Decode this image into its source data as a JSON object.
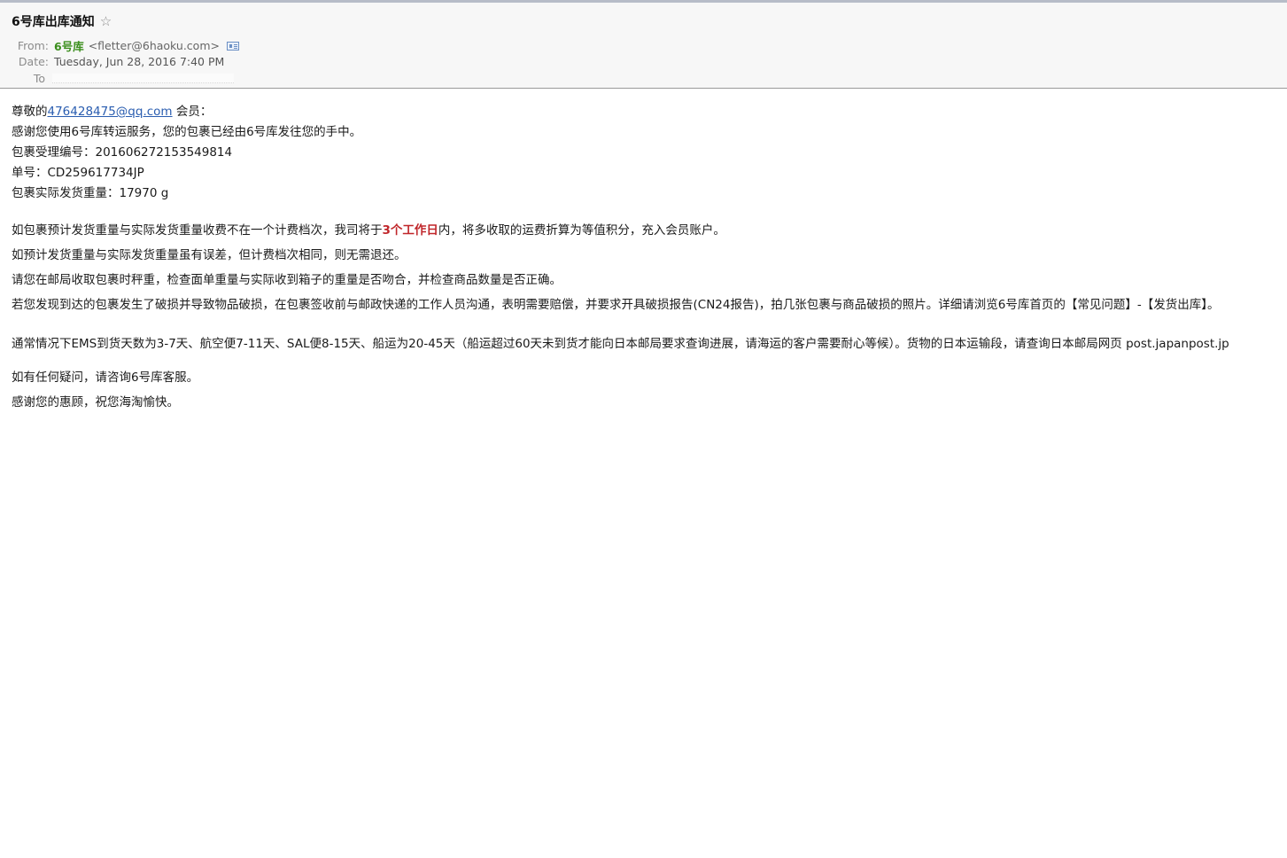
{
  "header": {
    "subject": "6号库出库通知",
    "from_label": "From:",
    "from_name": "6号库",
    "from_address": "<fletter@6haoku.com>",
    "date_label": "Date:",
    "date_value": "Tuesday, Jun 28, 2016 7:40 PM",
    "to_label": "To"
  },
  "body": {
    "greeting_prefix": "尊敬的",
    "greeting_email": "476428475@qq.com",
    "greeting_suffix": " 会员：",
    "line_thanks": "感谢您使用6号库转运服务，您的包裹已经由6号库发往您的手中。",
    "line_accept_no": "包裹受理编号：201606272153549814",
    "line_tracking": "单号：CD259617734JP",
    "line_weight": "包裹实际发货重量：17970 g",
    "refund_prefix": "如包裹预计发货重量与实际发货重量收费不在一个计费档次，我司将于",
    "refund_highlight": "3个工作日",
    "refund_suffix": "内，将多收取的运费折算为等值积分，充入会员账户。",
    "line_no_refund": "如预计发货重量与实际发货重量虽有误差，但计费档次相同，则无需退还。",
    "line_check": "请您在邮局收取包裹时秤重，检查面单重量与实际收到箱子的重量是否吻合，并检查商品数量是否正确。",
    "line_damage": "若您发现到达的包裹发生了破损并导致物品破损，在包裹签收前与邮政快递的工作人员沟通，表明需要赔偿，并要求开具破损报告(CN24报告)，拍几张包裹与商品破损的照片。详细请浏览6号库首页的【常见问题】-【发货出库】。",
    "line_shipping": "通常情况下EMS到货天数为3-7天、航空便7-11天、SAL便8-15天、船运为20-45天（船运超过60天未到货才能向日本邮局要求查询进展，请海运的客户需要耐心等候）。货物的日本运输段，请查询日本邮局网页 post.japanpost.jp",
    "line_contact": "如有任何疑问，请咨询6号库客服。",
    "line_closing": "感谢您的惠顾，祝您海淘愉快。"
  },
  "icons": {
    "star": "star-outline-icon",
    "contact_card": "contact-card-icon"
  },
  "colors": {
    "sender_name": "#3a8e1c",
    "link": "#2a5db0",
    "highlight": "#c0262a",
    "header_bg": "#f7f7f7"
  }
}
